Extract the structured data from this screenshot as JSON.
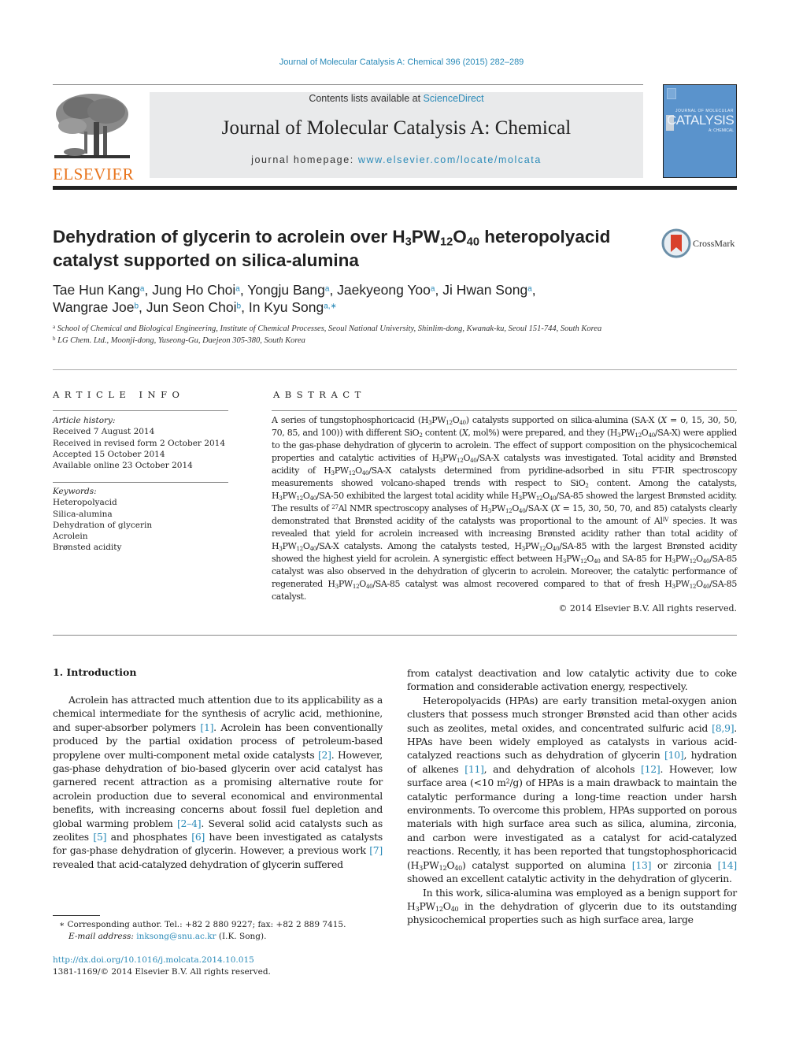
{
  "journal_reference": "Journal of Molecular Catalysis A: Chemical 396 (2015) 282–289",
  "header": {
    "publisher_logo_text": "ELSEVIER",
    "contents_prefix": "Contents lists available at ",
    "contents_link": "ScienceDirect",
    "journal_title": "Journal of Molecular Catalysis A: Chemical",
    "homepage_prefix": "journal homepage: ",
    "homepage_link": "www.elsevier.com/locate/molcata",
    "cover": {
      "small": "JOURNAL OF MOLECULAR",
      "big": "CATALYSIS",
      "sub": "A: CHEMICAL"
    },
    "colors": {
      "link": "#2a8ab8",
      "logo": "#e8741c",
      "cover": "#5a93cc",
      "band": "#e9eaeb"
    }
  },
  "article": {
    "title_parts": [
      "Dehydration of glycerin to acrolein over H",
      "3",
      "PW",
      "12",
      "O",
      "40",
      " heteropolyacid catalyst supported on silica-alumina"
    ],
    "crossmark_label": "CrossMark",
    "authors": [
      {
        "name": "Tae Hun Kang",
        "aff": "a"
      },
      {
        "name": "Jung Ho Choi",
        "aff": "a"
      },
      {
        "name": "Yongju Bang",
        "aff": "a"
      },
      {
        "name": "Jaekyeong Yoo",
        "aff": "a"
      },
      {
        "name": "Ji Hwan Song",
        "aff": "a"
      },
      {
        "name": "Wangrae Joe",
        "aff": "b"
      },
      {
        "name": "Jun Seon Choi",
        "aff": "b"
      },
      {
        "name": "In Kyu Song",
        "aff": "a,∗"
      }
    ],
    "affiliations": [
      {
        "mark": "a",
        "text": "School of Chemical and Biological Engineering, Institute of Chemical Processes, Seoul National University, Shinlim-dong, Kwanak-ku, Seoul 151-744, South Korea"
      },
      {
        "mark": "b",
        "text": "LG Chem. Ltd., Moonji-dong, Yuseong-Gu, Daejeon 305-380, South Korea"
      }
    ]
  },
  "article_info": {
    "heading": "ARTICLE INFO",
    "history_label": "Article history:",
    "history": [
      "Received 7 August 2014",
      "Received in revised form 2 October 2014",
      "Accepted 15 October 2014",
      "Available online 23 October 2014"
    ],
    "keywords_label": "Keywords:",
    "keywords": [
      "Heteropolyacid",
      "Silica-alumina",
      "Dehydration of glycerin",
      "Acrolein",
      "Brønsted acidity"
    ]
  },
  "abstract": {
    "heading": "ABSTRACT",
    "html": "A series of tungstophosphoricacid (H<sub>3</sub>PW<sub>12</sub>O<sub>40</sub>) catalysts supported on silica-alumina (SA-X (<i>X</i> = 0, 15, 30, 50, 70, 85, and 100)) with different SiO<sub>2</sub> content (<i>X</i>, mol%) were prepared, and they (H<sub>3</sub>PW<sub>12</sub>O<sub>40</sub>/SA-X) were applied to the gas-phase dehydration of glycerin to acrolein. The effect of support composition on the physicochemical properties and catalytic activities of H<sub>3</sub>PW<sub>12</sub>O<sub>40</sub>/SA-X catalysts was investigated. Total acidity and Brønsted acidity of H<sub>3</sub>PW<sub>12</sub>O<sub>40</sub>/SA-X catalysts determined from pyridine-adsorbed in situ FT-IR spectroscopy measurements showed volcano-shaped trends with respect to SiO<sub>2</sub> content. Among the catalysts, H<sub>3</sub>PW<sub>12</sub>O<sub>40</sub>/SA-50 exhibited the largest total acidity while H<sub>3</sub>PW<sub>12</sub>O<sub>40</sub>/SA-85 showed the largest Brønsted acidity. The results of <sup>27</sup>Al NMR spectroscopy analyses of H<sub>3</sub>PW<sub>12</sub>O<sub>40</sub>/SA-X (<i>X</i> = 15, 30, 50, 70, and 85) catalysts clearly demonstrated that Brønsted acidity of the catalysts was proportional to the amount of Al<sup>IV</sup> species. It was revealed that yield for acrolein increased with increasing Brønsted acidity rather than total acidity of H<sub>3</sub>PW<sub>12</sub>O<sub>40</sub>/SA-X catalysts. Among the catalysts tested, H<sub>3</sub>PW<sub>12</sub>O<sub>40</sub>/SA-85 with the largest Brønsted acidity showed the highest yield for acrolein. A synergistic effect between H<sub>3</sub>PW<sub>12</sub>O<sub>40</sub> and SA-85 for H<sub>3</sub>PW<sub>12</sub>O<sub>40</sub>/SA-85 catalyst was also observed in the dehydration of glycerin to acrolein. Moreover, the catalytic performance of regenerated H<sub>3</sub>PW<sub>12</sub>O<sub>40</sub>/SA-85 catalyst was almost recovered compared to that of fresh H<sub>3</sub>PW<sub>12</sub>O<sub>40</sub>/SA-85 catalyst.",
    "copyright": "© 2014 Elsevier B.V. All rights reserved."
  },
  "body": {
    "section_title": "1.  Introduction",
    "left_column_html": "<p>Acrolein has attracted much attention due to its applicability as a chemical intermediate for the synthesis of acrylic acid, methionine, and super-absorber polymers <a class=\"link\">[1]</a>. Acrolein has been conventionally produced by the partial oxidation process of petroleum-based propylene over multi-component metal oxide catalysts <a class=\"link\">[2]</a>. However, gas-phase dehydration of bio-based glycerin over acid catalyst has garnered recent attraction as a promising alternative route for acrolein production due to several economical and environmental benefits, with increasing concerns about fossil fuel depletion and global warming problem <a class=\"link\">[2–4]</a>. Several solid acid catalysts such as zeolites <a class=\"link\">[5]</a> and phosphates <a class=\"link\">[6]</a> have been investigated as catalysts for gas-phase dehydration of glycerin. However, a previous work <a class=\"link\">[7]</a> revealed that acid-catalyzed dehydration of glycerin suffered</p>",
    "right_column_html": "<p class=\"noindent\">from catalyst deactivation and low catalytic activity due to coke formation and considerable activation energy, respectively.</p><p>Heteropolyacids (HPAs) are early transition metal-oxygen anion clusters that possess much stronger Brønsted acid than other acids such as zeolites, metal oxides, and concentrated sulfuric acid <a class=\"link\">[8,9]</a>. HPAs have been widely employed as catalysts in various acid-catalyzed reactions such as dehydration of glycerin <a class=\"link\">[10]</a>, hydration of alkenes <a class=\"link\">[11]</a>, and dehydration of alcohols <a class=\"link\">[12]</a>. However, low surface area (&lt;10 m<sup>2</sup>/g) of HPAs is a main drawback to maintain the catalytic performance during a long-time reaction under harsh environments. To overcome this problem, HPAs supported on porous materials with high surface area such as silica, alumina, zirconia, and carbon were investigated as a catalyst for acid-catalyzed reactions. Recently, it has been reported that tungstophosphoricacid (H<sub>3</sub>PW<sub>12</sub>O<sub>40</sub>) catalyst supported on alumina <a class=\"link\">[13]</a> or zirconia <a class=\"link\">[14]</a> showed an excellent catalytic activity in the dehydration of glycerin.</p><p>In this work, silica-alumina was employed as a benign support for H<sub>3</sub>PW<sub>12</sub>O<sub>40</sub> in the dehydration of glycerin due to its outstanding physicochemical properties such as high surface area, large</p>"
  },
  "footnote": {
    "corresponding": "∗  Corresponding author. Tel.: +82 2 880 9227; fax: +82 2 889 7415.",
    "email_label": "E-mail address: ",
    "email": "inksong@snu.ac.kr",
    "email_suffix": " (I.K. Song).",
    "doi": "http://dx.doi.org/10.1016/j.molcata.2014.10.015",
    "issn": "1381-1169/© 2014 Elsevier B.V. All rights reserved."
  }
}
